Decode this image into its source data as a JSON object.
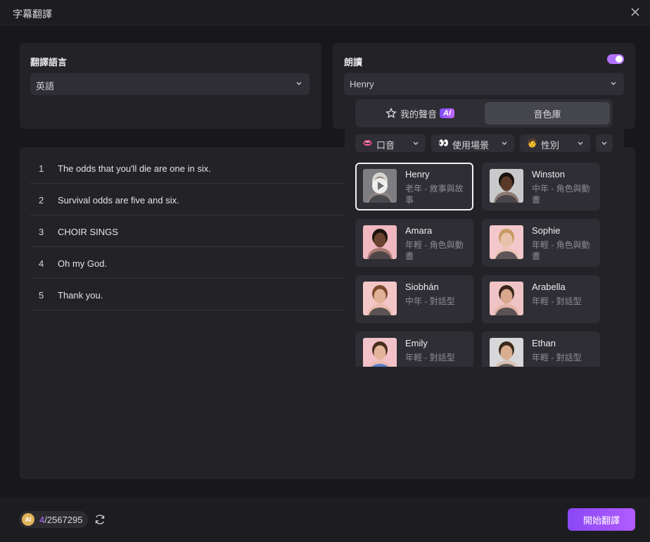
{
  "window": {
    "title": "字幕翻譯"
  },
  "translate_language": {
    "label": "翻譯語言",
    "value": "英語"
  },
  "narration": {
    "label": "朗讀",
    "enabled": true,
    "voice_value": "Henry",
    "tabs": {
      "my_voice": "我的聲音",
      "ai_badge": "AI",
      "library": "音色庫",
      "active": "library"
    },
    "filters": [
      {
        "icon": "lips-icon",
        "glyph": "👄",
        "label": "口音"
      },
      {
        "icon": "eyes-icon",
        "glyph": "👀",
        "label": "使用場景"
      },
      {
        "icon": "person-icon",
        "glyph": "🧑",
        "label": "性別"
      }
    ],
    "voices": [
      {
        "name": "Henry",
        "desc": "老年 - 敘事與故事",
        "selected": true,
        "skin": "#9a8c86",
        "hair": "#d6d3d0",
        "bg": "#7d7d82"
      },
      {
        "name": "Winston",
        "desc": "中年 - 角色與動畫",
        "selected": false,
        "skin": "#5a3a28",
        "hair": "#1a1410",
        "bg": "#c9c9cc"
      },
      {
        "name": "Amara",
        "desc": "年輕 - 角色與動畫",
        "selected": false,
        "skin": "#6a4430",
        "hair": "#1b120c",
        "bg": "#f0b7c0"
      },
      {
        "name": "Sophie",
        "desc": "年輕 - 角色與動畫",
        "selected": false,
        "skin": "#e8c2aa",
        "hair": "#c79a62",
        "bg": "#f3c8cc"
      },
      {
        "name": "Siobhán",
        "desc": "中年 - 對話型",
        "selected": false,
        "skin": "#e2b096",
        "hair": "#7a4a2c",
        "bg": "#f3c6c8"
      },
      {
        "name": "Arabella",
        "desc": "年輕 - 對話型",
        "selected": false,
        "skin": "#d8a78e",
        "hair": "#3a2618",
        "bg": "#f0c4c6"
      },
      {
        "name": "Emily",
        "desc": "年輕 - 對話型",
        "selected": false,
        "skin": "#e4b59c",
        "hair": "#4a2e1c",
        "bg": "#f3c2c8"
      },
      {
        "name": "Ethan",
        "desc": "年輕 - 對話型",
        "selected": false,
        "skin": "#d9ad90",
        "hair": "#3b2a1c",
        "bg": "#d8d8da"
      }
    ]
  },
  "subtitles": [
    {
      "num": "1",
      "text": "The odds that you'll die are one in six."
    },
    {
      "num": "2",
      "text": "Survival odds are five and six."
    },
    {
      "num": "3",
      "text": "CHOIR SINGS"
    },
    {
      "num": "4",
      "text": "Oh my God."
    },
    {
      "num": "5",
      "text": "Thank you."
    }
  ],
  "footer": {
    "coin_label": "AI",
    "credits_used": "4",
    "credits_total": "/2567295",
    "start_label": "開始翻譯"
  },
  "colors": {
    "accent": "#b072ff",
    "background": "#18181b",
    "panel": "#222227",
    "control": "#2e2e34"
  }
}
